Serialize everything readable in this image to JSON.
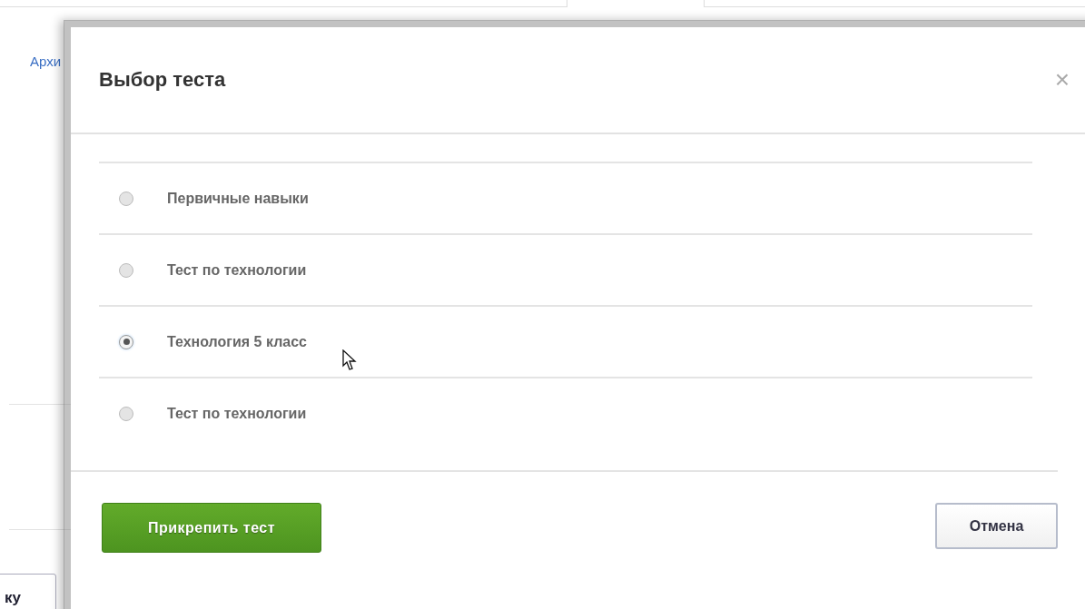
{
  "background": {
    "link": "Архи",
    "button": "ку"
  },
  "dialog": {
    "title": "Выбор теста",
    "close": "×",
    "options": [
      {
        "label": "Первичные навыки",
        "selected": false
      },
      {
        "label": "Тест по технологии",
        "selected": false
      },
      {
        "label": "Технология 5 класс",
        "selected": true
      },
      {
        "label": "Тест по технологии",
        "selected": false
      }
    ],
    "primary_button": "Прикрепить тест",
    "cancel_button": "Отмена"
  }
}
